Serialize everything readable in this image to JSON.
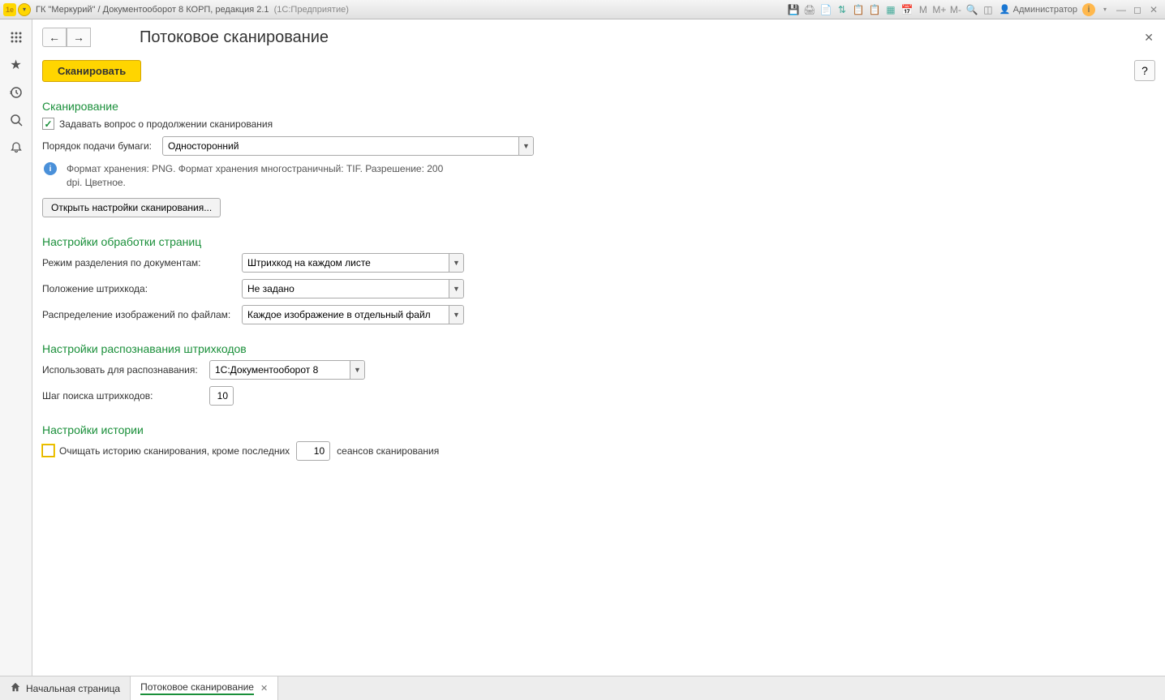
{
  "titlebar": {
    "app_icon_text": "1e",
    "title_main": "ГК \"Меркурий\" / Документооборот 8 КОРП, редакция 2.1",
    "title_gray": "(1С:Предприятие)",
    "user_label": "Администратор",
    "m_labels": [
      "M",
      "M+",
      "M-"
    ]
  },
  "page": {
    "title": "Потоковое сканирование",
    "scan_button": "Сканировать",
    "help_button": "?"
  },
  "scanning": {
    "section_title": "Сканирование",
    "ask_continue_label": "Задавать вопрос о продолжении сканирования",
    "ask_continue_checked": true,
    "paper_feed_label": "Порядок подачи бумаги:",
    "paper_feed_value": "Односторонний",
    "info_text": "Формат хранения: PNG. Формат хранения многостраничный: TIF. Разрешение: 200 dpi. Цветное.",
    "open_settings_button": "Открыть настройки сканирования..."
  },
  "page_processing": {
    "section_title": "Настройки обработки страниц",
    "split_mode_label": "Режим разделения по документам:",
    "split_mode_value": "Штрихкод на каждом листе",
    "barcode_position_label": "Положение штрихкода:",
    "barcode_position_value": "Не задано",
    "image_distribution_label": "Распределение изображений по файлам:",
    "image_distribution_value": "Каждое изображение в отдельный файл"
  },
  "barcode_recognition": {
    "section_title": "Настройки распознавания штрихкодов",
    "use_for_recognition_label": "Использовать для распознавания:",
    "use_for_recognition_value": "1С:Документооборот 8",
    "search_step_label": "Шаг поиска штрихкодов:",
    "search_step_value": "10"
  },
  "history": {
    "section_title": "Настройки истории",
    "clear_history_label": "Очищать историю сканирования, кроме последних",
    "clear_history_checked": false,
    "clear_history_value": "10",
    "clear_history_suffix": "сеансов сканирования"
  },
  "tabs": {
    "home": "Начальная страница",
    "current": "Потоковое сканирование"
  }
}
